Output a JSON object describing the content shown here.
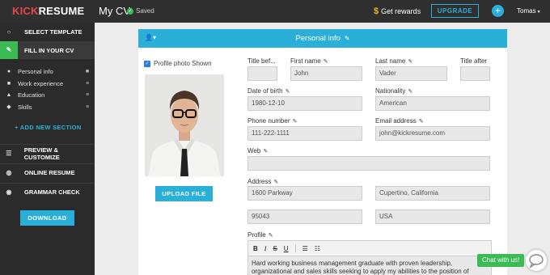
{
  "header": {
    "logo_kick": "KICK",
    "logo_resume": "RESUME",
    "cv_title": "My CV",
    "saved_label": "Saved",
    "rewards_label": "Get rewards",
    "upgrade_label": "UPGRADE",
    "user_name": "Tomas",
    "accent": "#2ab0d8"
  },
  "sidebar": {
    "select_template": "SELECT TEMPLATE",
    "fill_in": "FILL IN YOUR CV",
    "sub_items": [
      {
        "label": "Personal info",
        "icon": "user-icon",
        "right_icon": "lock-icon"
      },
      {
        "label": "Work experience",
        "icon": "briefcase-icon",
        "right_icon": "drag-handle-icon"
      },
      {
        "label": "Education",
        "icon": "graduation-cap-icon",
        "right_icon": "drag-handle-icon"
      },
      {
        "label": "Skills",
        "icon": "skills-icon",
        "right_icon": "drag-handle-icon"
      }
    ],
    "add_section": "+ ADD NEW SECTION",
    "preview": "PREVIEW & CUSTOMIZE",
    "online": "ONLINE RESUME",
    "grammar": "GRAMMAR CHECK",
    "download": "DOWNLOAD"
  },
  "section": {
    "title": "Personal info",
    "photo_checkbox_label": "Profile photo Shown",
    "upload_label": "UPLOAD FILE"
  },
  "form": {
    "title_before": {
      "label": "Title bef...",
      "value": ""
    },
    "first_name": {
      "label": "First name",
      "value": "John"
    },
    "last_name": {
      "label": "Last name",
      "value": "Vader"
    },
    "title_after": {
      "label": "Title after",
      "value": ""
    },
    "dob": {
      "label": "Date of birth",
      "value": "1980-12-10"
    },
    "nationality": {
      "label": "Nationality",
      "value": "American"
    },
    "phone": {
      "label": "Phone number",
      "value": "111-222-1111"
    },
    "email": {
      "label": "Email address",
      "value": "john@kickresume.com"
    },
    "web": {
      "label": "Web",
      "value": ""
    },
    "address": {
      "label": "Address",
      "value": "1600 Parkway"
    },
    "city": {
      "value": "Cupertino, California"
    },
    "zip": {
      "value": "95043"
    },
    "country": {
      "value": "USA"
    },
    "profile": {
      "label": "Profile",
      "value": "Hard working business management graduate with proven leadership, organizational and sales skills seeking to apply my abilities to the position of"
    }
  },
  "toolbar": {
    "bold": "B",
    "italic": "I",
    "strike": "S",
    "underline": "U"
  },
  "chat": {
    "label": "Chat with us!"
  }
}
